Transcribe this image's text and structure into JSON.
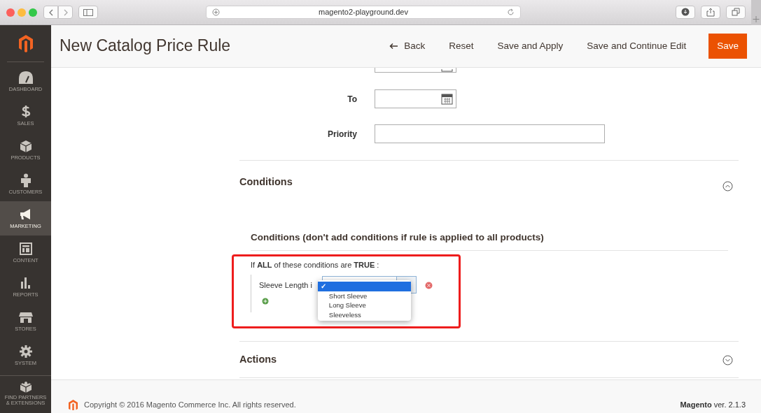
{
  "browser": {
    "url": "magento2-playground.dev"
  },
  "sidebar": {
    "items": [
      {
        "label": "DASHBOARD",
        "selected": false
      },
      {
        "label": "SALES",
        "selected": false
      },
      {
        "label": "PRODUCTS",
        "selected": false
      },
      {
        "label": "CUSTOMERS",
        "selected": false
      },
      {
        "label": "MARKETING",
        "selected": true
      },
      {
        "label": "CONTENT",
        "selected": false
      },
      {
        "label": "REPORTS",
        "selected": false
      },
      {
        "label": "STORES",
        "selected": false
      },
      {
        "label": "SYSTEM",
        "selected": false
      },
      {
        "label": "FIND PARTNERS & EXTENSIONS",
        "selected": false
      }
    ]
  },
  "page": {
    "title": "New Catalog Price Rule",
    "actions": [
      {
        "label": "Back",
        "kind": "back"
      },
      {
        "label": "Reset",
        "kind": "link"
      },
      {
        "label": "Save and Apply",
        "kind": "link"
      },
      {
        "label": "Save and Continue Edit",
        "kind": "link"
      },
      {
        "label": "Save",
        "kind": "primary"
      }
    ]
  },
  "form": {
    "fields": [
      {
        "kind": "date-cut"
      },
      {
        "label": "To",
        "kind": "date"
      },
      {
        "label": "Priority",
        "kind": "text"
      }
    ]
  },
  "sections": [
    {
      "title": "Conditions",
      "expanded": true,
      "subtitle": "Conditions (don't add conditions if rule is applied to all products)",
      "highlight": true,
      "rule": "If **ALL**  of these conditions are **TRUE** :",
      "condition": {
        "attribute": "Sleeve Length i",
        "check_mark": "✓",
        "options": [
          {
            "selected": true
          },
          {
            "label": "Short Sleeve",
            "selected": false
          },
          {
            "label": "Long Sleeve",
            "selected": false
          },
          {
            "label": "Sleeveless",
            "selected": false
          }
        ]
      }
    },
    {
      "title": "Actions",
      "expanded": false
    }
  ],
  "footer": {
    "copyright": "Copyright © 2016 Magento Commerce Inc. All rights reserved.",
    "version": "**Magento** ver. 2.1.3"
  }
}
